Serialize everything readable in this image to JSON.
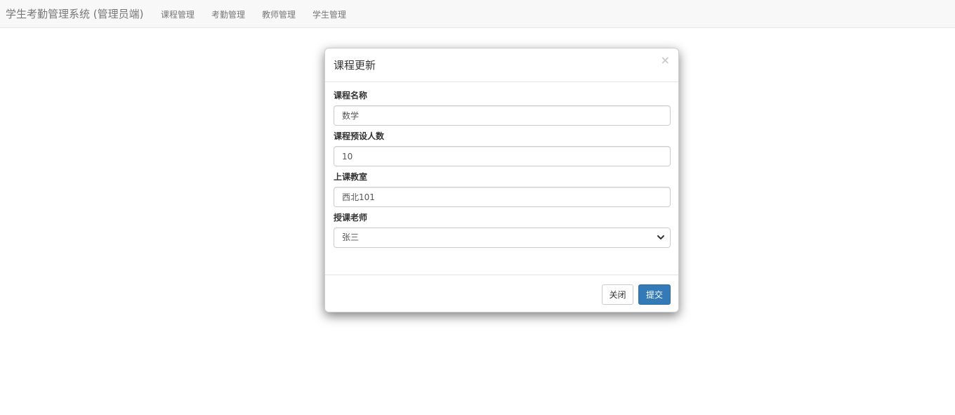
{
  "navbar": {
    "brand": "学生考勤管理系统 (管理员端)",
    "links": [
      {
        "label": "课程管理"
      },
      {
        "label": "考勤管理"
      },
      {
        "label": "教师管理"
      },
      {
        "label": "学生管理"
      }
    ]
  },
  "modal": {
    "title": "课程更新",
    "close_symbol": "×",
    "fields": {
      "course_name": {
        "label": "课程名称",
        "value": "数学"
      },
      "capacity": {
        "label": "课程预设人数",
        "value": "10"
      },
      "classroom": {
        "label": "上课教室",
        "value": "西北101"
      },
      "teacher": {
        "label": "授课老师",
        "selected": "张三"
      }
    },
    "buttons": {
      "close_label": "关闭",
      "submit_label": "提交"
    }
  },
  "colors": {
    "navbar_bg": "#f8f8f8",
    "primary": "#337ab7"
  },
  "icons": {
    "select_arrow": "chevron-down-icon",
    "close": "close-icon"
  }
}
